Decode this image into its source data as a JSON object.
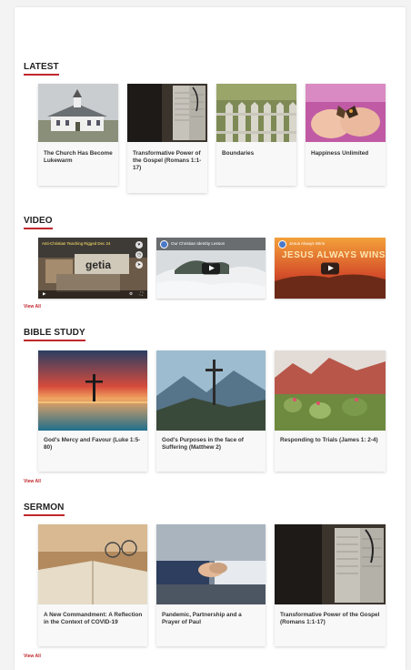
{
  "sections": {
    "latest": {
      "title": "LATEST",
      "cards": [
        {
          "title": "The Church Has Become Lukewarm",
          "image": "church-photo"
        },
        {
          "title": "Transformative Power of the Gospel (Romans 1:1-17)",
          "image": "open-bible-photo"
        },
        {
          "title": "Boundaries",
          "image": "picket-fence-photo"
        },
        {
          "title": "Happiness Unlimited",
          "image": "butterfly-in-hands-photo"
        }
      ]
    },
    "video": {
      "title": "VIDEO",
      "view_all": "View All",
      "videos": [
        {
          "title": "Anti-Christian Teaching Rigged Dec 24",
          "image": "video-thumbnail-1"
        },
        {
          "title": "Our Christian Identity Lesson",
          "image": "video-thumbnail-2"
        },
        {
          "title": "Jesus Always Wins",
          "overlay": "JESUS ALWAYS WINS",
          "image": "video-thumbnail-3"
        }
      ]
    },
    "bible_study": {
      "title": "BIBLE STUDY",
      "view_all": "View All",
      "cards": [
        {
          "title": "God's Mercy and Favour (Luke 1:5-80)",
          "image": "cross-sunset-photo"
        },
        {
          "title": "God's Purposes in the face of Suffering (Matthew 2)",
          "image": "cross-mountain-photo"
        },
        {
          "title": "Responding to Trials (James 1: 2-4)",
          "image": "desert-cactus-photo"
        }
      ]
    },
    "sermon": {
      "title": "SERMON",
      "view_all": "View All",
      "cards": [
        {
          "title": "A New Commandment: A Reflection in the Context of COVID-19",
          "image": "bible-glasses-photo"
        },
        {
          "title": "Pandemic, Partnership and a Prayer of Paul",
          "image": "handshake-photo"
        },
        {
          "title": "Transformative Power of the Gospel (Romans 1:1-17)",
          "image": "open-bible-photo"
        }
      ]
    }
  },
  "colors": {
    "accent": "#c0272d",
    "background": "#ffffff"
  }
}
